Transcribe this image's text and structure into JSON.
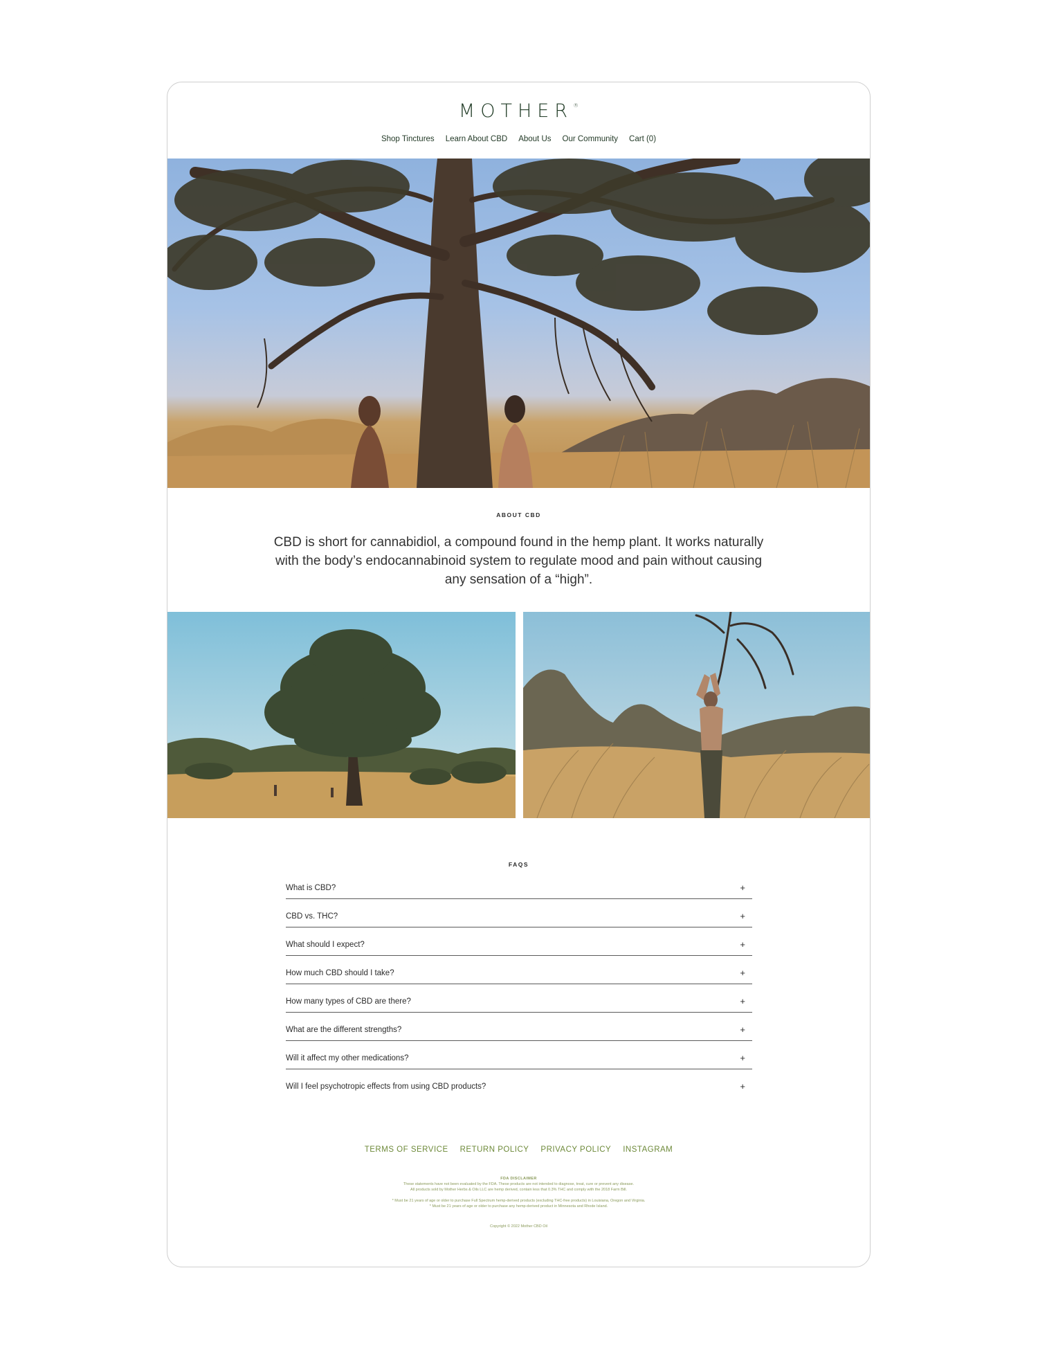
{
  "brand": {
    "logo": "MOTHER",
    "registered": "®"
  },
  "nav": {
    "items": [
      {
        "label": "Shop Tinctures"
      },
      {
        "label": "Learn About CBD"
      },
      {
        "label": "About Us"
      },
      {
        "label": "Our Community"
      },
      {
        "label": "Cart (0)"
      }
    ]
  },
  "about": {
    "eyebrow": "ABOUT CBD",
    "text": "CBD is short for cannabidiol, a compound found in the hemp plant. It works naturally with the body’s endocannabinoid system to regulate mood and pain without causing any sensation of a “high”."
  },
  "faq": {
    "eyebrow": "FAQS",
    "items": [
      {
        "question": "What is CBD?",
        "toggle": "+"
      },
      {
        "question": "CBD vs. THC?",
        "toggle": "+"
      },
      {
        "question": "What should I expect?",
        "toggle": "+"
      },
      {
        "question": "How much CBD should I take?",
        "toggle": "+"
      },
      {
        "question": "How many types of CBD are there?",
        "toggle": "+"
      },
      {
        "question": "What are the different strengths?",
        "toggle": "+"
      },
      {
        "question": "Will it affect my other medications?",
        "toggle": "+"
      },
      {
        "question": "Will I feel psychotropic effects from using CBD products?",
        "toggle": "+"
      }
    ]
  },
  "footer": {
    "links": [
      {
        "label": "TERMS OF SERVICE"
      },
      {
        "label": "RETURN POLICY"
      },
      {
        "label": "PRIVACY POLICY"
      },
      {
        "label": "INSTAGRAM"
      }
    ],
    "disclaimer_title": "FDA DISCLAIMER",
    "disclaimer_line1": "These statements have not been evaluated by the FDA. These products are not intended to diagnose, treat, cure or prevent any disease.",
    "disclaimer_line2": "All products sold by Mother Herbs & Oils LLC are hemp derived, contain less that 0.3% THC and comply with the 2018 Farm Bill.",
    "age_line1": "* Must be 21 years of age or older to purchase Full Spectrum hemp-derived products (excluding THC-free products) in Louisiana, Oregon and Virginia.",
    "age_line2": "* Must be 21 years of age or older to purchase any hemp-derived product in Minnesota and Rhode Island.",
    "copyright": "Copyright © 2022 Mother CBD Oil"
  },
  "colors": {
    "brand_green": "#1f3a24",
    "footer_green": "#6e8a3a"
  }
}
